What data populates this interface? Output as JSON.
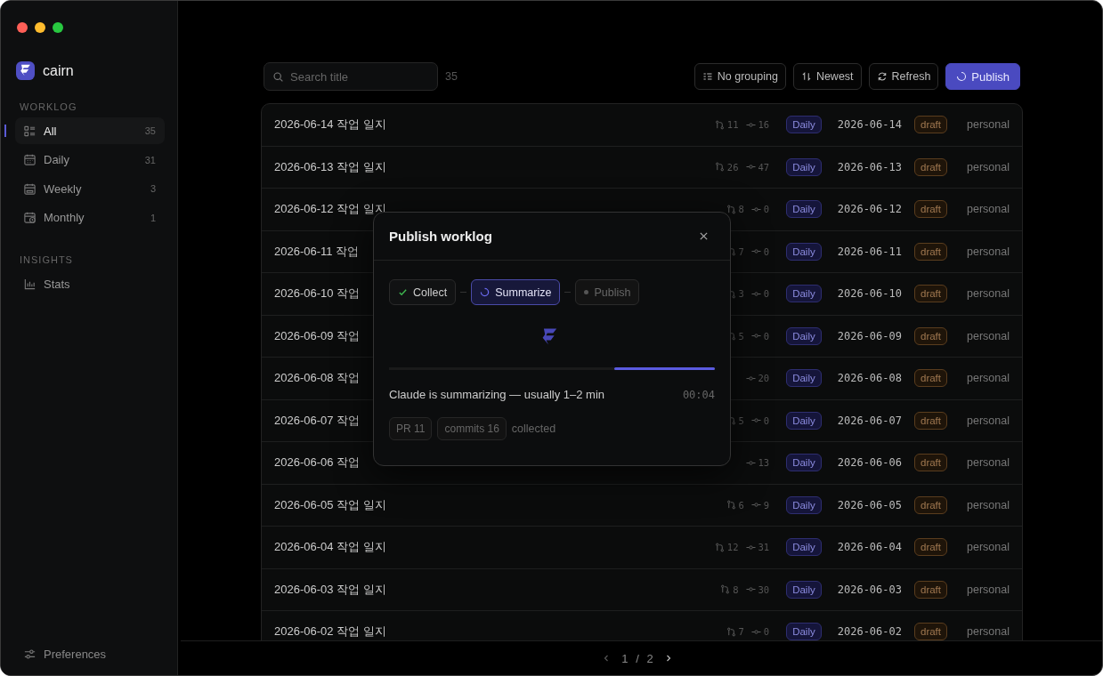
{
  "app": {
    "name": "cairn"
  },
  "sidebar": {
    "sections": [
      {
        "heading": "WORKLOG",
        "items": [
          {
            "label": "All",
            "count": "35",
            "selected": true
          },
          {
            "label": "Daily",
            "count": "31",
            "selected": false
          },
          {
            "label": "Weekly",
            "count": "3",
            "selected": false
          },
          {
            "label": "Monthly",
            "count": "1",
            "selected": false
          }
        ]
      },
      {
        "heading": "INSIGHTS",
        "items": [
          {
            "label": "Stats",
            "selected": false
          }
        ]
      }
    ],
    "footer": {
      "label": "Preferences"
    }
  },
  "toolbar": {
    "search": {
      "placeholder": "Search title"
    },
    "result_count": "35",
    "buttons": [
      {
        "label": "No grouping",
        "kind": "group"
      },
      {
        "label": "Newest",
        "kind": "sort"
      },
      {
        "label": "Refresh",
        "kind": "refresh"
      },
      {
        "label": "Publish",
        "kind": "primary"
      }
    ]
  },
  "table": {
    "rows": [
      {
        "title": "2026-06-14 작업 일지",
        "prs": "11",
        "commits": "16",
        "type": "Daily",
        "date": "2026-06-14",
        "status": "draft",
        "scope": "personal"
      },
      {
        "title": "2026-06-13 작업 일지",
        "prs": "26",
        "commits": "47",
        "type": "Daily",
        "date": "2026-06-13",
        "status": "draft",
        "scope": "personal"
      },
      {
        "title": "2026-06-12 작업 일지",
        "prs": "8",
        "commits": "0",
        "type": "Daily",
        "date": "2026-06-12",
        "status": "draft",
        "scope": "personal"
      },
      {
        "title": "2026-06-11 작업",
        "prs": "7",
        "commits": "0",
        "type": "Daily",
        "date": "2026-06-11",
        "status": "draft",
        "scope": "personal"
      },
      {
        "title": "2026-06-10 작업",
        "prs": "3",
        "commits": "0",
        "type": "Daily",
        "date": "2026-06-10",
        "status": "draft",
        "scope": "personal"
      },
      {
        "title": "2026-06-09 작업",
        "prs": "5",
        "commits": "0",
        "type": "Daily",
        "date": "2026-06-09",
        "status": "draft",
        "scope": "personal"
      },
      {
        "title": "2026-06-08 작업",
        "commits": "20",
        "type": "Daily",
        "date": "2026-06-08",
        "status": "draft",
        "scope": "personal"
      },
      {
        "title": "2026-06-07 작업",
        "prs": "5",
        "commits": "0",
        "type": "Daily",
        "date": "2026-06-07",
        "status": "draft",
        "scope": "personal"
      },
      {
        "title": "2026-06-06 작업",
        "commits": "13",
        "type": "Daily",
        "date": "2026-06-06",
        "status": "draft",
        "scope": "personal"
      },
      {
        "title": "2026-06-05 작업 일지",
        "prs": "6",
        "commits": "9",
        "type": "Daily",
        "date": "2026-06-05",
        "status": "draft",
        "scope": "personal"
      },
      {
        "title": "2026-06-04 작업 일지",
        "prs": "12",
        "commits": "31",
        "type": "Daily",
        "date": "2026-06-04",
        "status": "draft",
        "scope": "personal"
      },
      {
        "title": "2026-06-03 작업 일지",
        "prs": "8",
        "commits": "30",
        "type": "Daily",
        "date": "2026-06-03",
        "status": "draft",
        "scope": "personal"
      },
      {
        "title": "2026-06-02 작업 일지",
        "prs": "7",
        "commits": "0",
        "type": "Daily",
        "date": "2026-06-02",
        "status": "draft",
        "scope": "personal"
      }
    ]
  },
  "pagination": {
    "page": "1",
    "separator": "/",
    "total": "2"
  },
  "dialog": {
    "title": "Publish worklog",
    "steps": [
      {
        "label": "Collect",
        "kind": "done"
      },
      {
        "label": "Summarize",
        "kind": "active"
      },
      {
        "label": "Publish",
        "kind": "pending"
      }
    ],
    "progress": {
      "level": 0.31
    },
    "message": "Claude is summarizing — usually 1–2 min",
    "elapsed": "00:04",
    "chips": [
      "PR 11",
      "commits 16"
    ],
    "chips_suffix": "collected"
  }
}
